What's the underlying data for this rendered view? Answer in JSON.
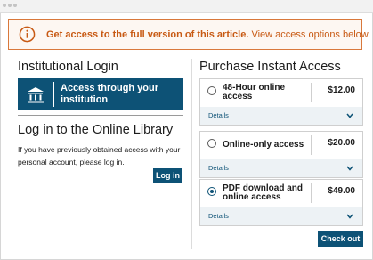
{
  "banner": {
    "strong": "Get access to the full version of this article.",
    "rest": "View access options below.",
    "icon": "info-icon",
    "accent": "#c85a14"
  },
  "left": {
    "institutional_heading": "Institutional Login",
    "institution_button": "Access through your institution",
    "institution_icon": "institution-icon",
    "library_heading": "Log in to the Online Library",
    "library_text": "If you have previously obtained access with your personal account, please log in.",
    "login_button": "Log in"
  },
  "right": {
    "heading": "Purchase Instant Access",
    "options": [
      {
        "label": "48-Hour online access",
        "price": "$12.00",
        "details": "Details",
        "selected": false
      },
      {
        "label": "Online-only access",
        "price": "$20.00",
        "details": "Details",
        "selected": false
      },
      {
        "label": "PDF download and online access",
        "price": "$49.00",
        "details": "Details",
        "selected": true
      }
    ],
    "checkout_button": "Check out"
  },
  "colors": {
    "brand": "#0d5276",
    "banner_border": "#d9783b",
    "details_bg": "#edf2f5"
  }
}
